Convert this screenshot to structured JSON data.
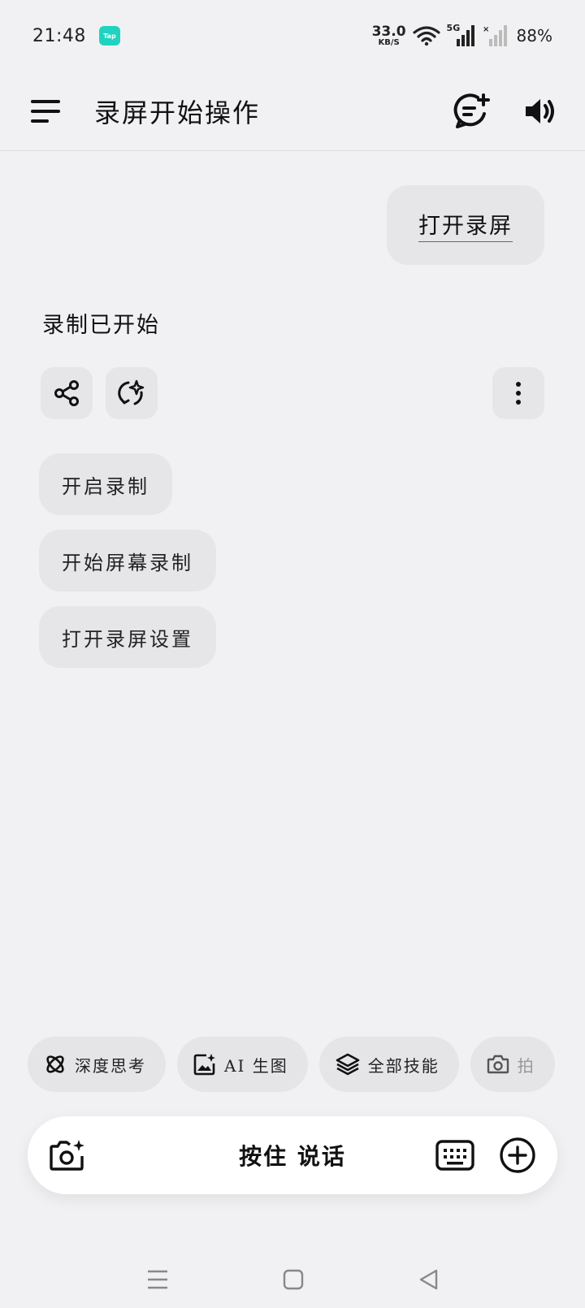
{
  "status_bar": {
    "time": "21:48",
    "app_badge": "Tap",
    "net_speed_value": "33.0",
    "net_speed_unit": "KB/S",
    "network": "5G",
    "battery": "88%"
  },
  "app_bar": {
    "title": "录屏开始操作",
    "menu_icon": "menu-icon",
    "new_chat_icon": "new-chat-icon",
    "speaker_icon": "speaker-icon"
  },
  "chat": {
    "user_message": "打开录屏",
    "assistant_reply": "录制已开始"
  },
  "suggestions": [
    {
      "label": "开启录制"
    },
    {
      "label": "开始屏幕录制"
    },
    {
      "label": "打开录屏设置"
    }
  ],
  "skills": [
    {
      "label": "深度思考",
      "icon": "atom-icon"
    },
    {
      "label": "AI 生图",
      "icon": "image-sparkle-icon"
    },
    {
      "label": "全部技能",
      "icon": "layers-icon"
    },
    {
      "label": "拍",
      "icon": "camera-icon"
    }
  ],
  "input_bar": {
    "hold_to_talk": "按住 说话"
  },
  "colors": {
    "background": "#f1f1f3",
    "chip": "#e6e6e8",
    "input": "#ffffff",
    "accent_badge": "#1fd3c0"
  }
}
